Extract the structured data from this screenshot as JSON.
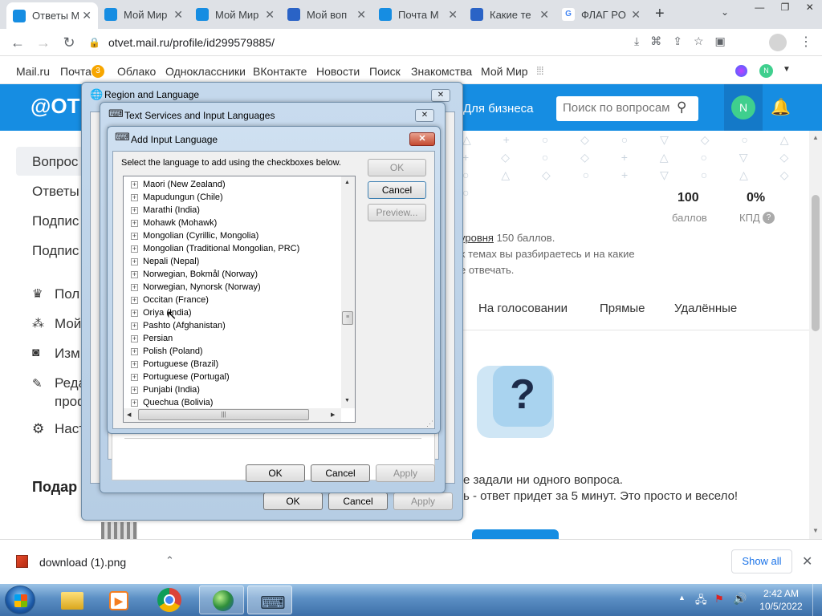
{
  "browser": {
    "tabs": [
      {
        "title": "Ответы М",
        "fav": "#168de2",
        "icon": "question-icon"
      },
      {
        "title": "Мой Мир",
        "fav": "#168de2",
        "icon": "moimir-icon"
      },
      {
        "title": "Мой Мир",
        "fav": "#168de2",
        "icon": "moimir-icon"
      },
      {
        "title": "Мой воп",
        "fav": "#2a63c6",
        "icon": "otvet-icon"
      },
      {
        "title": "Почта М",
        "fav": "#168de2",
        "icon": "mail-icon"
      },
      {
        "title": "Какие те",
        "fav": "#2a63c6",
        "icon": "otvet-icon"
      },
      {
        "title": "ФЛАГ РО",
        "fav": "#ffffff",
        "icon": "google-icon"
      }
    ],
    "url": "otvet.mail.ru/profile/id299579885/",
    "bookmarks": [
      "Mail.ru",
      "Почта",
      "Облако",
      "Одноклассники",
      "ВКонтакте",
      "Новости",
      "Поиск",
      "Знакомства",
      "Мой Мир"
    ],
    "mail_badge": "3",
    "avatar_letter": "N"
  },
  "site": {
    "logo": "ОТ",
    "business": "Для бизнеса",
    "search_placeholder": "Поиск по вопросам",
    "avatar": "N",
    "side_items": [
      "Вопрос",
      "Ответы",
      "Подпис",
      "Подпис"
    ],
    "side_items2": [
      "Пол",
      "Мой",
      "Изм",
      "Реда",
      "проф",
      "Наст"
    ],
    "gifts": "Подар",
    "points_value": "100",
    "points_label": "баллов",
    "kpd_value": "0%",
    "kpd_label": "КПД",
    "level_link": "уровня",
    "level_text": " 150 баллов.",
    "info2": "х темах вы разбираетесь и на какие",
    "info3": "е отвечать.",
    "tabs": [
      "На голосовании",
      "Прямые",
      "Удалённые"
    ],
    "empty1": "е задали ни одного вопроса.",
    "empty2": "ь - ответ придет за 5 минут. Это просто и весело!"
  },
  "dialog_region": {
    "title": "Region and Language",
    "ok": "OK",
    "cancel": "Cancel",
    "apply": "Apply"
  },
  "dialog_text_services": {
    "title": "Text Services and Input Languages",
    "ok": "OK",
    "cancel": "Cancel",
    "apply": "Apply"
  },
  "dialog_add_lang": {
    "title": "Add Input Language",
    "instruction": "Select the language to add using the checkboxes below.",
    "ok": "OK",
    "cancel": "Cancel",
    "preview": "Preview...",
    "languages": [
      "Maori (New Zealand)",
      "Mapudungun (Chile)",
      "Marathi (India)",
      "Mohawk (Mohawk)",
      "Mongolian (Cyrillic, Mongolia)",
      "Mongolian (Traditional Mongolian, PRC)",
      "Nepali (Nepal)",
      "Norwegian, Bokmål (Norway)",
      "Norwegian, Nynorsk (Norway)",
      "Occitan (France)",
      "Oriya (India)",
      "Pashto (Afghanistan)",
      "Persian",
      "Polish (Poland)",
      "Portuguese (Brazil)",
      "Portuguese (Portugal)",
      "Punjabi (India)",
      "Quechua (Bolivia)"
    ]
  },
  "download": {
    "file": "download (1).png",
    "show_all": "Show all"
  },
  "taskbar": {
    "time": "2:42 AM",
    "date": "10/5/2022"
  }
}
